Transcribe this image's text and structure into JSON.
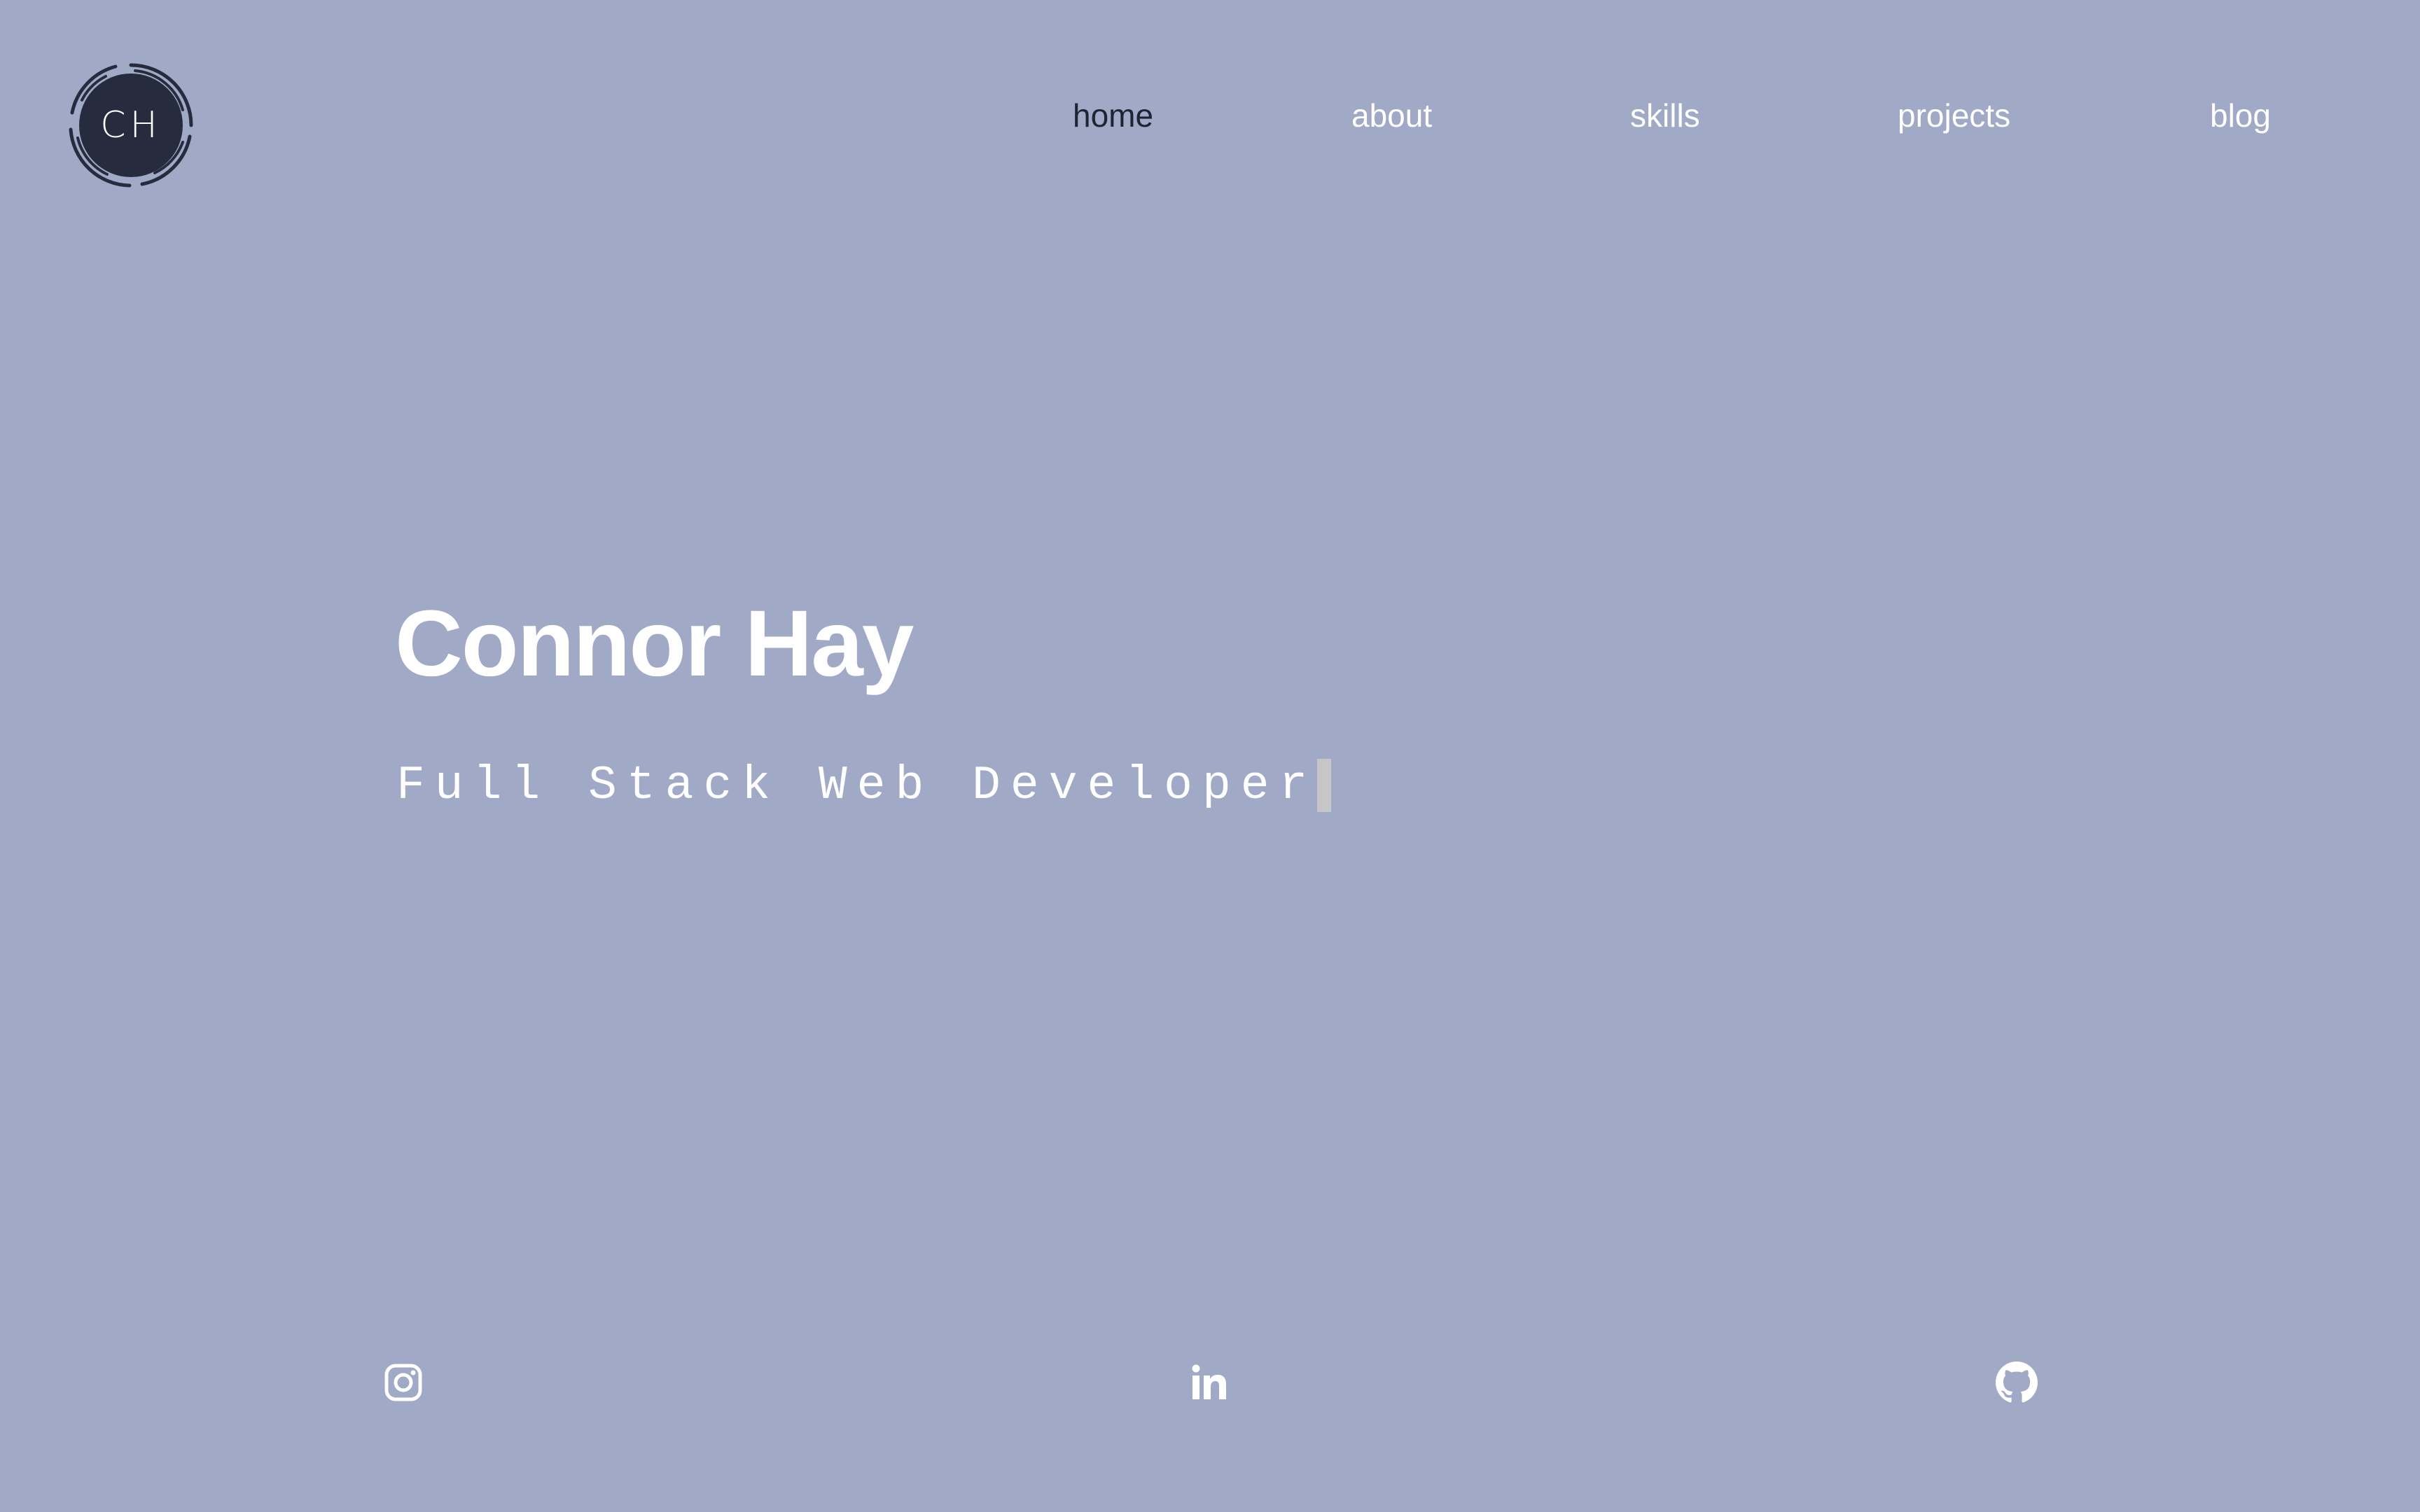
{
  "logo": {
    "initials": "CH",
    "icon": "ch-monogram-logo"
  },
  "nav": {
    "items": [
      {
        "label": "home",
        "active": true
      },
      {
        "label": "about",
        "active": false
      },
      {
        "label": "skills",
        "active": false
      },
      {
        "label": "projects",
        "active": false
      },
      {
        "label": "blog",
        "active": false
      }
    ]
  },
  "hero": {
    "name": "Connor Hay",
    "role": "Full Stack Web Developer"
  },
  "social": [
    {
      "icon": "instagram-icon"
    },
    {
      "icon": "linkedin-icon"
    },
    {
      "icon": "github-icon"
    }
  ],
  "colors": {
    "background": "#a0a9c6",
    "text": "#ffffff",
    "active_nav": "#1e2433",
    "logo_fill": "#262c3d",
    "cursor": "#c6c6c9"
  }
}
